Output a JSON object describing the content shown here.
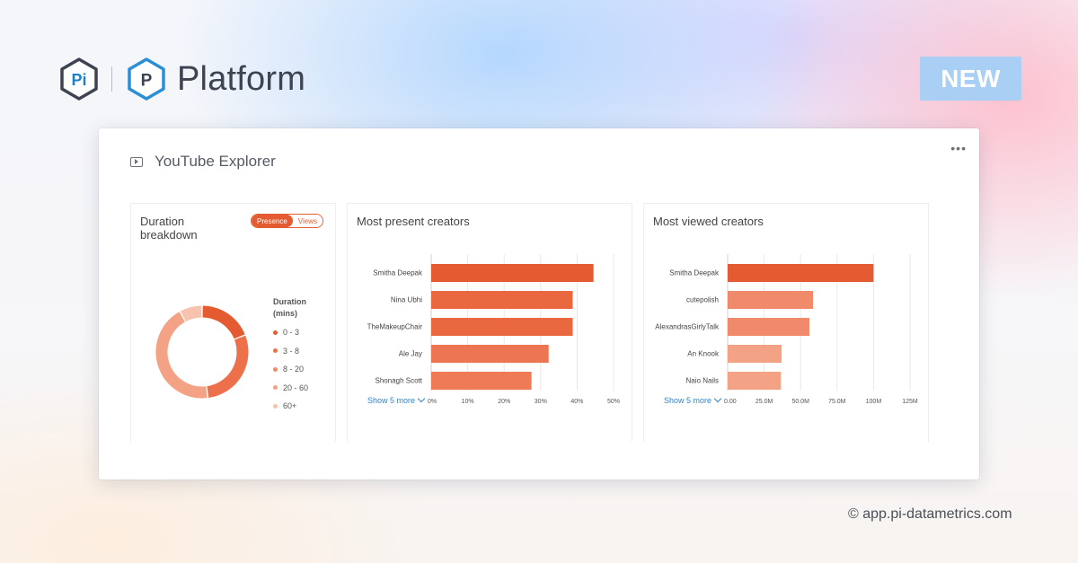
{
  "brand": {
    "short": "Pi",
    "product_letter": "P",
    "name": "Platform"
  },
  "badge": "NEW",
  "footer": "© app.pi-datametrics.com",
  "explorer": {
    "title": "YouTube Explorer",
    "menu": "•••"
  },
  "colors": {
    "accent": "#e55b31",
    "link": "#2f86c8",
    "badge": "#a9cff4"
  },
  "duration_panel": {
    "title_line1": "Duration",
    "title_line2": "breakdown",
    "toggle": {
      "presence": "Presence",
      "views": "Views",
      "active": "Presence"
    },
    "legend_title_1": "Duration",
    "legend_title_2": "(mins)"
  },
  "present_panel": {
    "title": "Most present creators",
    "show_more": "Show 5 more"
  },
  "viewed_panel": {
    "title": "Most viewed creators",
    "show_more": "Show 5 more"
  },
  "chart_data": [
    {
      "type": "pie",
      "title": "",
      "legend_title": "Duration (mins)",
      "legend_position": "right",
      "categories": [
        "0 - 3",
        "3 - 8",
        "8 - 20",
        "20 - 60",
        "60+"
      ],
      "values": [
        19,
        29,
        0,
        44,
        8
      ],
      "colors": [
        "#e55b31",
        "#ec704a",
        "#f08a6a",
        "#f4a286",
        "#f7c2ae"
      ]
    },
    {
      "type": "bar",
      "orientation": "horizontal",
      "title": "Most present creators",
      "categories": [
        "Smitha Deepak",
        "Nina Ubhi",
        "TheMakeupChair",
        "Ale Jay",
        "Shonagh Scott"
      ],
      "values": [
        44.5,
        38.8,
        38.8,
        32.2,
        27.5
      ],
      "xlim": [
        0,
        50
      ],
      "ticks": [
        "0%",
        "10%",
        "20%",
        "30%",
        "40%",
        "50%"
      ],
      "grid": true,
      "colors": [
        "#e55b31",
        "#ea683f",
        "#ea683f",
        "#ed7652",
        "#ee7a56"
      ]
    },
    {
      "type": "bar",
      "orientation": "horizontal",
      "title": "Most viewed creators",
      "categories": [
        "Smitha Deepak",
        "cutepolish",
        "AlexandrasGirlyTalk",
        "An Knook",
        "Naio Nails"
      ],
      "values": [
        100,
        58.5,
        56,
        37,
        36.5
      ],
      "xlim": [
        0,
        125
      ],
      "ticks": [
        "0.00",
        "25.0M",
        "50.0M",
        "75.0M",
        "100M",
        "125M"
      ],
      "grid": true,
      "colors": [
        "#e55b31",
        "#f08a6a",
        "#f08a6a",
        "#f4a286",
        "#f4a286"
      ]
    }
  ]
}
